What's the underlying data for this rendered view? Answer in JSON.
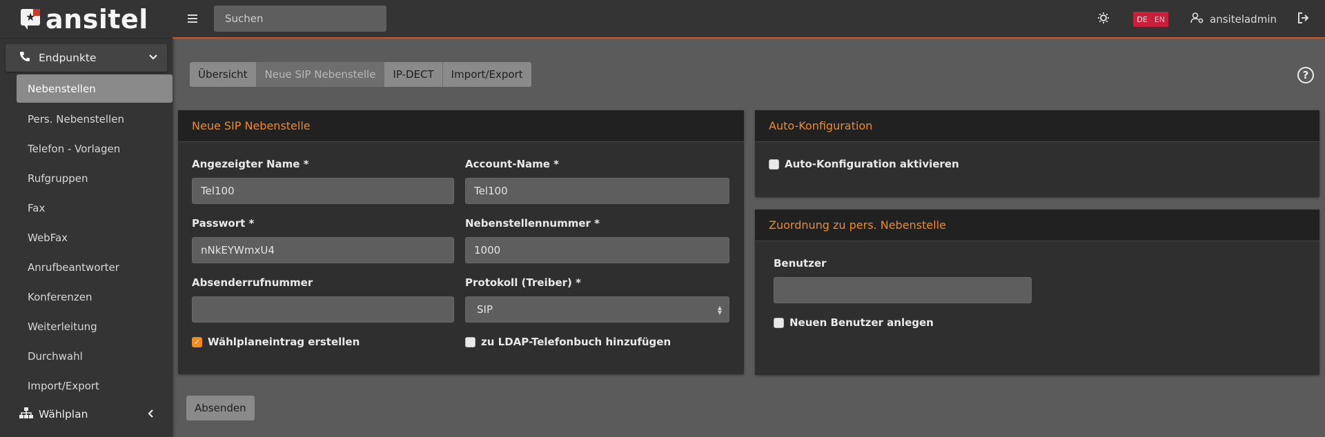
{
  "brand": {
    "name": "ansitel"
  },
  "topbar": {
    "search_placeholder": "Suchen",
    "lang_de": "DE",
    "lang_en": "EN",
    "username": "ansiteladmin"
  },
  "sidebar": {
    "group1": {
      "label": "Endpunkte",
      "icon": "phone-icon"
    },
    "items": [
      {
        "label": "Nebenstellen",
        "active": true
      },
      {
        "label": "Pers. Nebenstellen"
      },
      {
        "label": "Telefon - Vorlagen"
      },
      {
        "label": "Rufgruppen"
      },
      {
        "label": "Fax"
      },
      {
        "label": "WebFax"
      },
      {
        "label": "Anrufbeantworter"
      },
      {
        "label": "Konferenzen"
      },
      {
        "label": "Weiterleitung"
      },
      {
        "label": "Durchwahl"
      },
      {
        "label": "Import/Export"
      }
    ],
    "group2": {
      "label": "Wählplan",
      "icon": "sitemap-icon"
    }
  },
  "tabs": [
    {
      "label": "Übersicht"
    },
    {
      "label": "Neue SIP Nebenstelle",
      "active": true
    },
    {
      "label": "IP-DECT"
    },
    {
      "label": "Import/Export"
    }
  ],
  "form": {
    "title": "Neue SIP Nebenstelle",
    "display_name_label": "Angezeigter Name *",
    "display_name_value": "Tel100",
    "account_name_label": "Account-Name *",
    "account_name_value": "Tel100",
    "password_label": "Passwort *",
    "password_value": "nNkEYWmxU4",
    "extension_label": "Nebenstellennummer *",
    "extension_value": "1000",
    "caller_id_label": "Absenderrufnummer",
    "caller_id_value": "",
    "protocol_label": "Protokoll (Treiber) *",
    "protocol_value": "SIP",
    "dialplan_checkbox_label": "Wählplaneintrag erstellen",
    "dialplan_checked": true,
    "ldap_checkbox_label": "zu LDAP-Telefonbuch hinzufügen",
    "ldap_checked": false
  },
  "autoconfig": {
    "title": "Auto-Konfiguration",
    "checkbox_label": "Auto-Konfiguration aktivieren",
    "checked": false
  },
  "assignment": {
    "title": "Zuordnung zu pers. Nebenstelle",
    "user_label": "Benutzer",
    "user_value": "",
    "new_user_label": "Neuen Benutzer anlegen",
    "new_user_checked": false
  },
  "submit_label": "Absenden",
  "colors": {
    "accent": "#ef8a2a",
    "topbar_border": "#d9531e",
    "lang_badge": "#c8203a"
  }
}
